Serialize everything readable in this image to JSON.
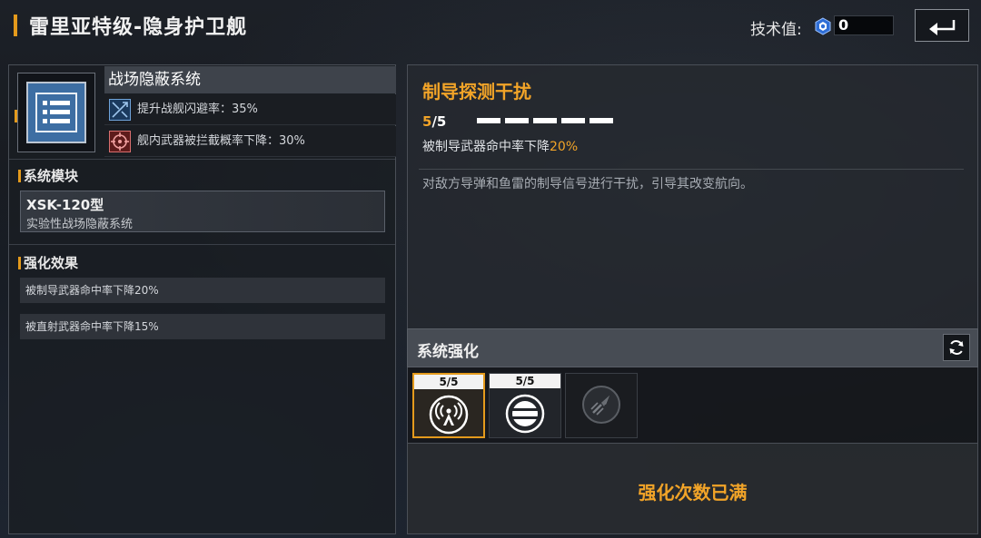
{
  "header": {
    "title": "雷里亚特级-隐身护卫舰",
    "tech_label": "技术值:",
    "tech_value": "0",
    "tech_icon": "tech-crystal-icon",
    "back_icon": "back-arrow-icon"
  },
  "system": {
    "icon": "list-module-icon",
    "name": "战场隐蔽系统",
    "effects": [
      {
        "icon": "evasion-icon",
        "text": "提升战舰闪避率：35%"
      },
      {
        "icon": "target-icon",
        "text": "舰内武器被拦截概率下降：30%"
      }
    ]
  },
  "module_section": {
    "title": "系统模块",
    "model_name": "XSK-120型",
    "model_desc": "实验性战场隐蔽系统"
  },
  "enhance_effects": {
    "title": "强化效果",
    "items": [
      "被制导武器命中率下降20%",
      "被直射武器命中率下降15%"
    ]
  },
  "perk": {
    "title": "制导探测干扰",
    "level_current": "5",
    "level_max": "/5",
    "pips_total": 5,
    "pips_filled": 5,
    "effect_prefix": "被制导武器命中率下降",
    "effect_value": "20%",
    "description": "对敌方导弹和鱼雷的制导信号进行干扰，引导其改变航向。"
  },
  "enhancement": {
    "title": "系统强化",
    "refresh_icon": "refresh-icon",
    "slots": [
      {
        "label": "5/5",
        "icon": "signal-tower-icon",
        "selected": true
      },
      {
        "label": "5/5",
        "icon": "striped-circle-icon",
        "selected": false
      },
      {
        "label": "",
        "icon": "missile-locked-icon",
        "selected": false
      }
    ],
    "status": "强化次数已满"
  },
  "colors": {
    "accent": "#e49a1c",
    "highlight": "#f2a428",
    "module_blue": "#3d6ea3"
  }
}
